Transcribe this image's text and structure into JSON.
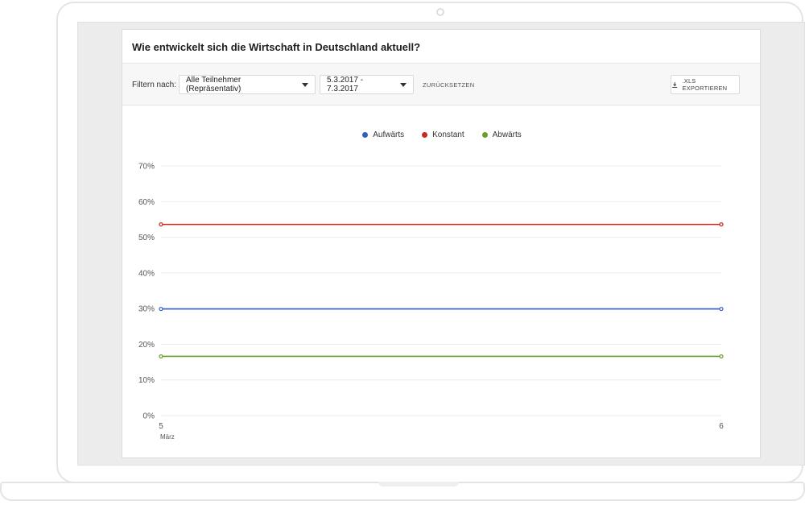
{
  "app": {
    "title": "Wie entwickelt sich die Wirtschaft in Deutschland aktuell?"
  },
  "filters": {
    "label": "Filtern nach:",
    "participants": "Alle Teilnehmer (Repräsentativ)",
    "daterange": "5.3.2017 - 7.3.2017",
    "reset": "ZURÜCKSETZEN",
    "export": ".XLS EXPORTIEREN"
  },
  "colors": {
    "aufwaerts": "#2f5fbf",
    "konstant": "#c8281e",
    "abwaerts": "#6a9f2a",
    "grid": "#ebebeb"
  },
  "chart_data": {
    "type": "line",
    "x": [
      5,
      6
    ],
    "x_tick_labels": [
      "5",
      "6"
    ],
    "x_sublabel": "März",
    "ylim": [
      0,
      70
    ],
    "y_ticks": [
      0,
      10,
      20,
      30,
      40,
      50,
      60,
      70
    ],
    "y_tick_labels": [
      "0%",
      "10%",
      "20%",
      "30%",
      "40%",
      "50%",
      "60%",
      "70%"
    ],
    "grid": true,
    "legend_position": "top-center",
    "series": [
      {
        "name": "Aufwärts",
        "color": "#2f5fbf",
        "values": [
          29.9,
          29.9
        ]
      },
      {
        "name": "Konstant",
        "color": "#c8281e",
        "values": [
          53.6,
          53.6
        ]
      },
      {
        "name": "Abwärts",
        "color": "#6a9f2a",
        "values": [
          16.6,
          16.6
        ]
      }
    ]
  }
}
